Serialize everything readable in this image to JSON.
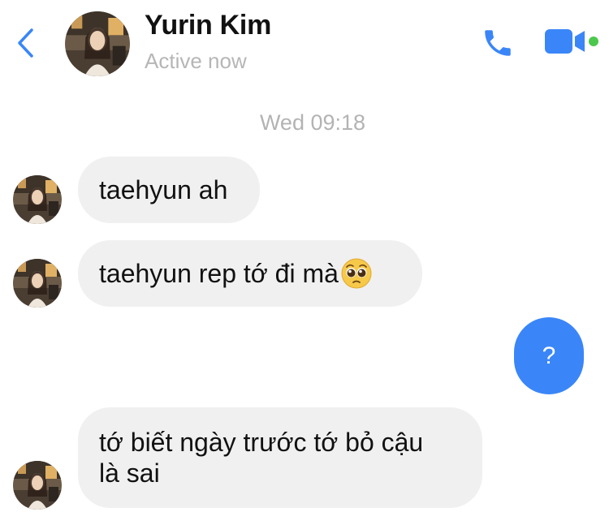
{
  "header": {
    "contact_name": "Yurin Kim",
    "status": "Active now",
    "accent_color": "#3a86f8",
    "online_color": "#4cc84c",
    "icons": [
      "chevron-left-icon",
      "phone-icon",
      "video-camera-icon"
    ]
  },
  "conversation": {
    "timestamp": "Wed 09:18",
    "messages": [
      {
        "sender": "them",
        "text": "taehyun ah"
      },
      {
        "sender": "them",
        "text": "taehyun rep tớ đi mà",
        "emoji": "pleading-face-emoji"
      },
      {
        "sender": "me",
        "text": "?"
      },
      {
        "sender": "them",
        "text": "tớ biết ngày trước tớ bỏ cậu\nlà sai"
      }
    ]
  }
}
